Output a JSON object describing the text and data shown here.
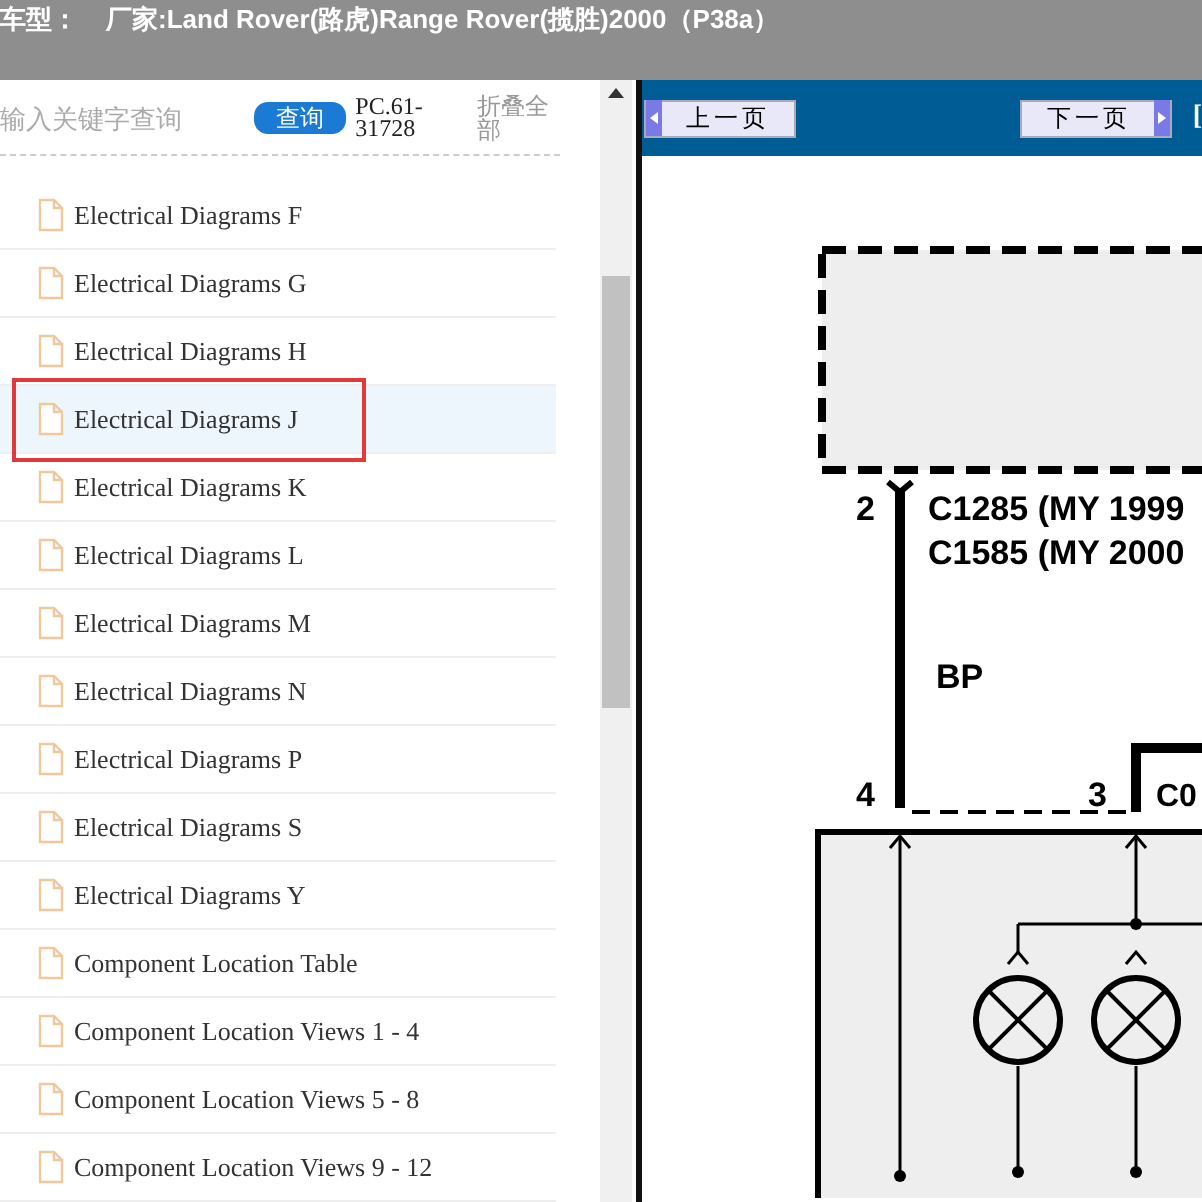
{
  "title_bar": {
    "label": "车型：",
    "value": "厂家:Land Rover(路虎)Range Rover(揽胜)2000（P38a）"
  },
  "search": {
    "placeholder": "输入关键字查询",
    "button": "查询",
    "code": "PC.61-31728",
    "collapse_all": "折叠全部"
  },
  "tree": {
    "items": [
      {
        "label": "Electrical Diagrams F",
        "selected": false,
        "highlighted": false
      },
      {
        "label": "Electrical Diagrams G",
        "selected": false,
        "highlighted": false
      },
      {
        "label": "Electrical Diagrams H",
        "selected": false,
        "highlighted": false
      },
      {
        "label": "Electrical Diagrams J",
        "selected": true,
        "highlighted": true
      },
      {
        "label": "Electrical Diagrams K",
        "selected": false,
        "highlighted": false
      },
      {
        "label": "Electrical Diagrams L",
        "selected": false,
        "highlighted": false
      },
      {
        "label": "Electrical Diagrams M",
        "selected": false,
        "highlighted": false
      },
      {
        "label": "Electrical Diagrams N",
        "selected": false,
        "highlighted": false
      },
      {
        "label": "Electrical Diagrams P",
        "selected": false,
        "highlighted": false
      },
      {
        "label": "Electrical Diagrams S",
        "selected": false,
        "highlighted": false
      },
      {
        "label": "Electrical Diagrams Y",
        "selected": false,
        "highlighted": false
      },
      {
        "label": "Component Location Table",
        "selected": false,
        "highlighted": false
      },
      {
        "label": "Component Location Views 1 - 4",
        "selected": false,
        "highlighted": false
      },
      {
        "label": "Component Location Views 5 - 8",
        "selected": false,
        "highlighted": false
      },
      {
        "label": "Component Location Views 9 - 12",
        "selected": false,
        "highlighted": false
      }
    ]
  },
  "viewer": {
    "prev_button": "上一页",
    "next_button": "下一页",
    "link": "[",
    "diagram": {
      "labels": [
        "2",
        "C1285  (MY 1999",
        "C1585  (MY 2000",
        "BP",
        "4",
        "3",
        "C0"
      ]
    }
  }
}
